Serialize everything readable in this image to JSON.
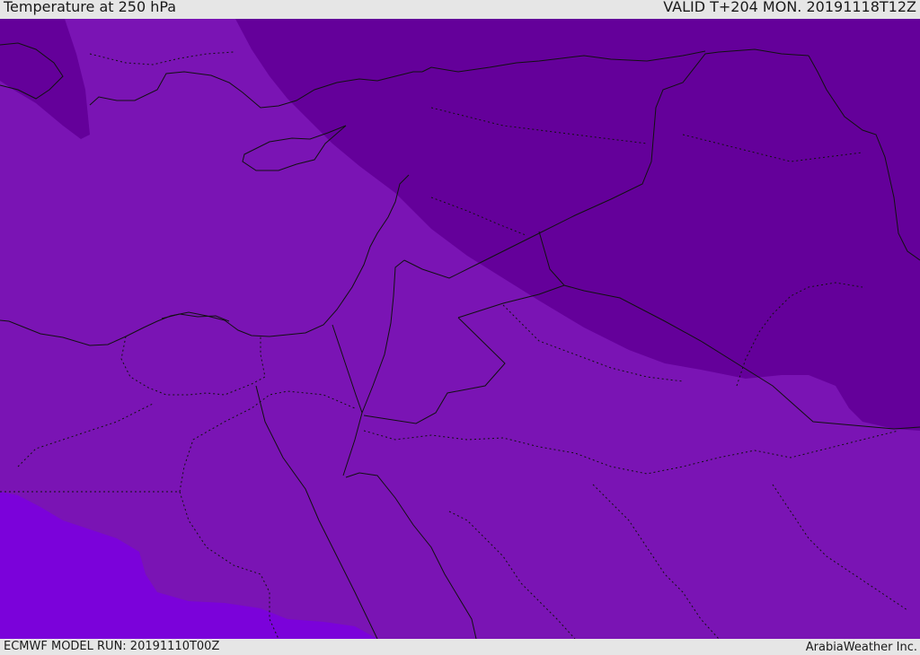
{
  "header": {
    "title": "Temperature at 250 hPa",
    "valid": "VALID T+204 MON. 20191118T12Z"
  },
  "footer": {
    "model_run": "ECMWF MODEL RUN: 20191110T00Z",
    "brand": "ArabiaWeather Inc."
  },
  "colors": {
    "cold_band": "#64009a",
    "main_field": "#7a14b4",
    "warm_band": "#7b02da",
    "coastline": "#111111"
  }
}
